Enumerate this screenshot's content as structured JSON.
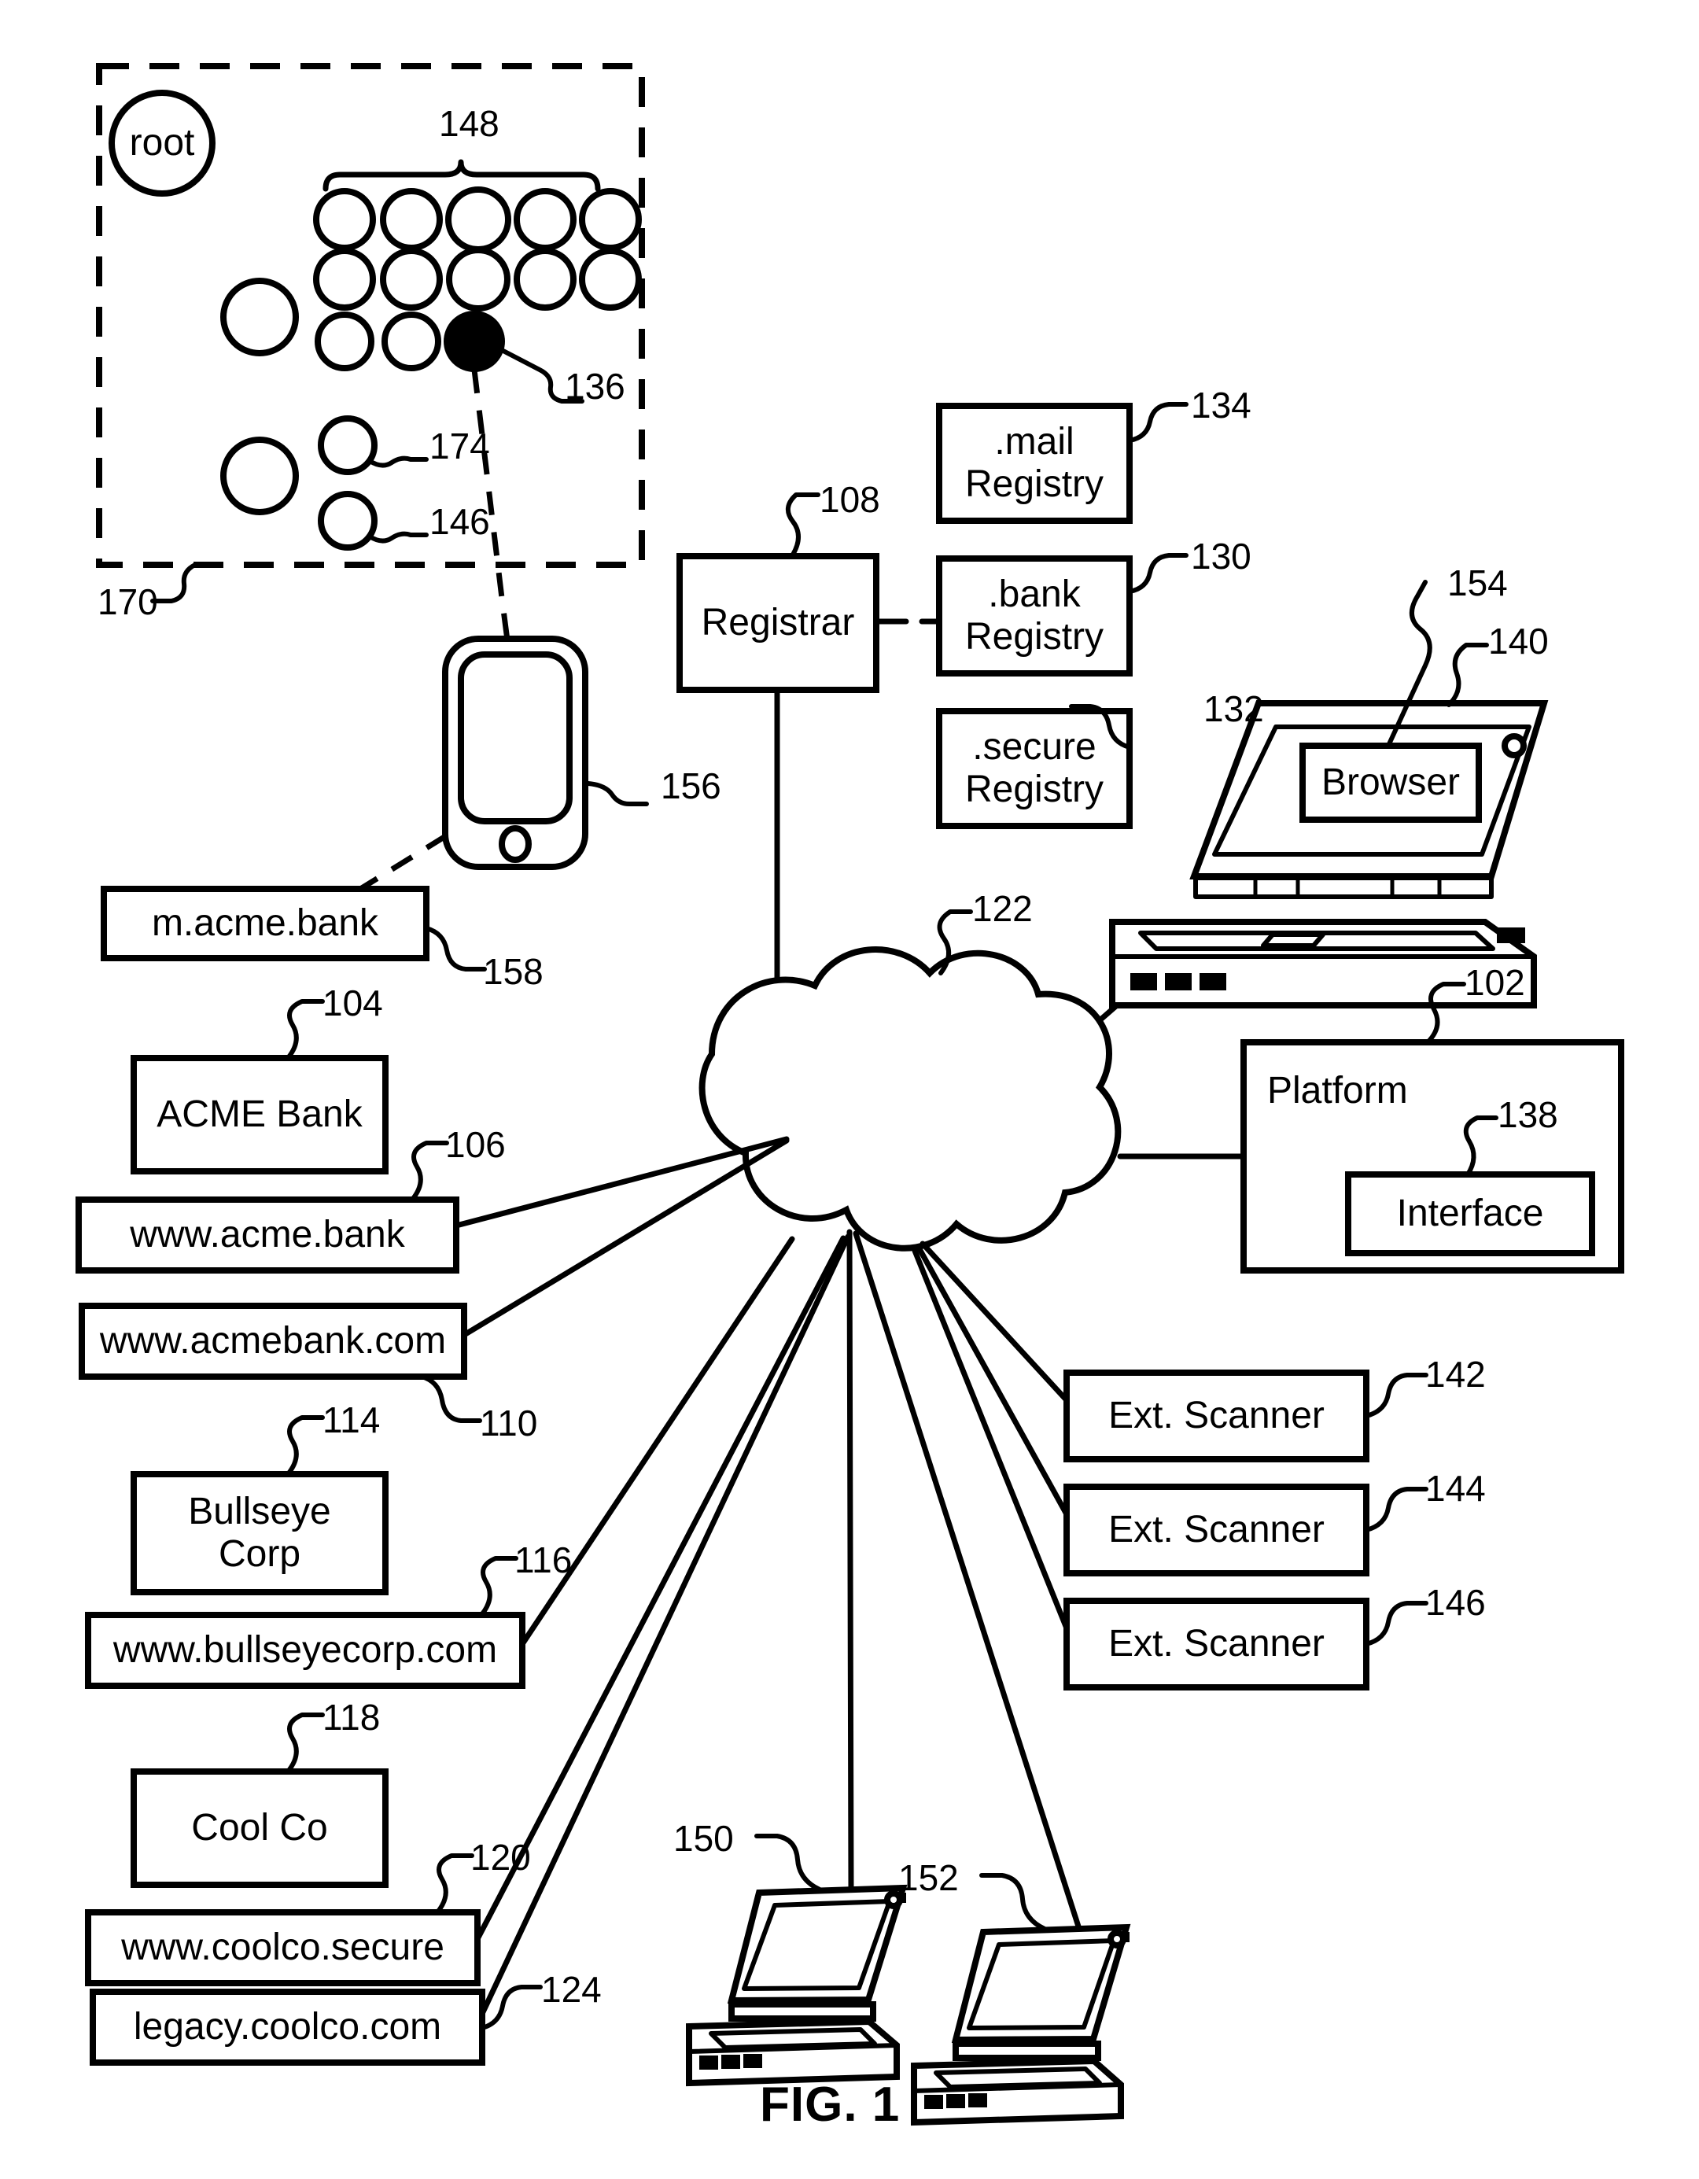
{
  "figure": {
    "caption": "FIG. 1",
    "root_node_label": "root"
  },
  "dns_zone": {
    "name": "dns-tree-dashed-region",
    "ref": "170",
    "brace_ref": "148",
    "highlighted_node_ref": "136",
    "node_ref_174": "174",
    "node_ref_146": "146"
  },
  "nodes": {
    "registrar": {
      "label": "Registrar",
      "ref": "108"
    },
    "mail_registry": {
      "label": ".mail\nRegistry",
      "line1": ".mail",
      "line2": "Registry",
      "ref": "134"
    },
    "bank_registry": {
      "label": ".bank\nRegistry",
      "line1": ".bank",
      "line2": "Registry",
      "ref": "130"
    },
    "secure_registry": {
      "label": ".secure\nRegistry",
      "line1": ".secure",
      "line2": "Registry",
      "ref": "132"
    },
    "browser": {
      "label": "Browser",
      "ref": "154"
    },
    "laptop_browser": {
      "ref": "140"
    },
    "platform": {
      "label": "Platform",
      "ref": "102"
    },
    "interface": {
      "label": "Interface",
      "ref": "138"
    },
    "network_cloud": {
      "ref": "122"
    },
    "smartphone": {
      "ref": "156"
    },
    "laptop_client_1": {
      "ref": "150"
    },
    "laptop_client_2": {
      "ref": "152"
    }
  },
  "domains": {
    "m_acme_bank": {
      "label": "m.acme.bank",
      "ref": "158"
    },
    "acme_bank_org": {
      "label": "ACME Bank",
      "ref": "104"
    },
    "www_acme_bank": {
      "label": "www.acme.bank",
      "ref": "106"
    },
    "www_acmebank_com": {
      "label": "www.acmebank.com",
      "ref": "110"
    },
    "bullseye_corp": {
      "label": "Bullseye\nCorp",
      "line1": "Bullseye",
      "line2": "Corp",
      "ref": "114"
    },
    "www_bullseyecorp_com": {
      "label": "www.bullseyecorp.com",
      "ref": "116"
    },
    "cool_co": {
      "label": "Cool Co",
      "ref": "118"
    },
    "www_coolco_secure": {
      "label": "www.coolco.secure",
      "ref": "120"
    },
    "legacy_coolco_com": {
      "label": "legacy.coolco.com",
      "ref": "124"
    }
  },
  "scanners": [
    {
      "label": "Ext. Scanner",
      "ref": "142"
    },
    {
      "label": "Ext. Scanner",
      "ref": "144"
    },
    {
      "label": "Ext. Scanner",
      "ref": "146"
    }
  ],
  "colors": {
    "stroke": "#000000",
    "fill": "#ffffff"
  }
}
